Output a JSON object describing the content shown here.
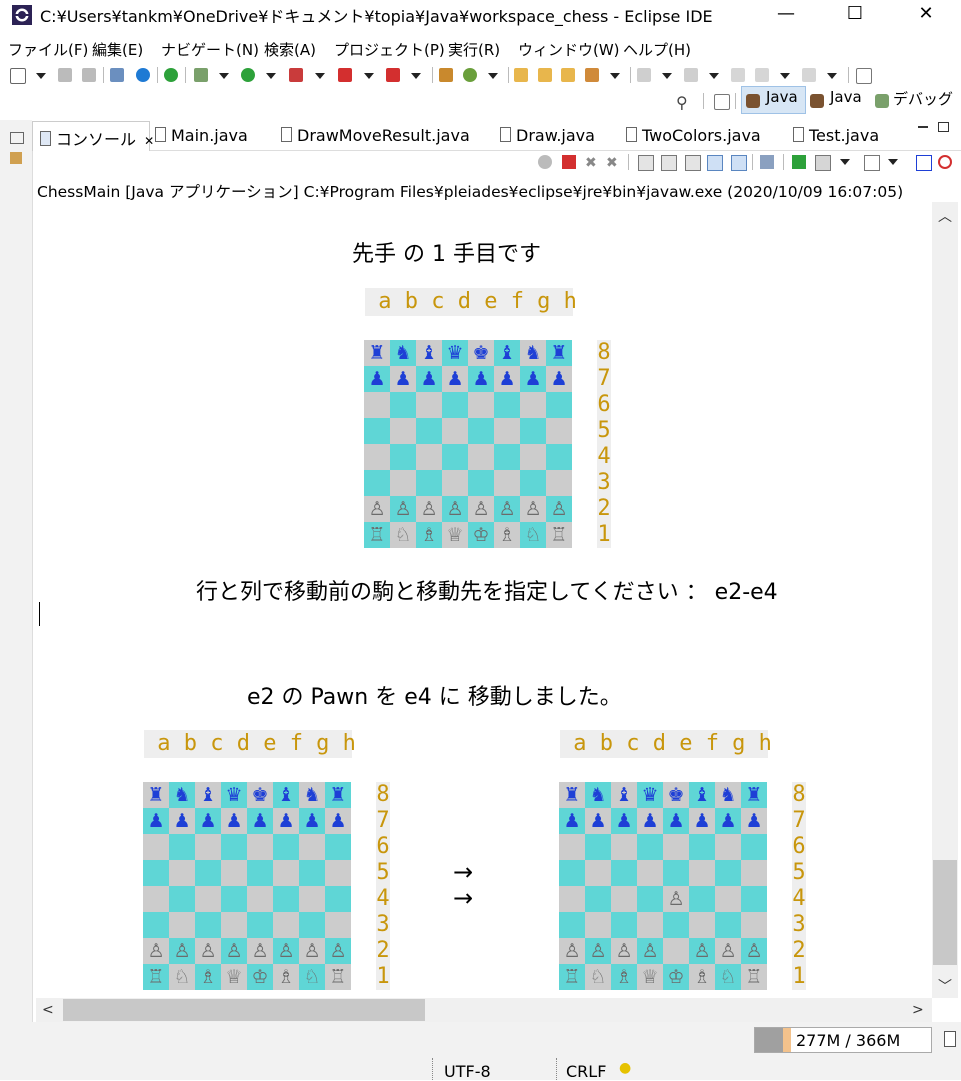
{
  "window": {
    "title": "C:¥Users¥tankm¥OneDrive¥ドキュメント¥topia¥Java¥workspace_chess - Eclipse IDE",
    "minimize_symbol": "—",
    "maximize_symbol": "☐",
    "close_symbol": "✕"
  },
  "menu": [
    "ファイル(F)",
    "編集(E)",
    "ナビゲート(N)",
    "検索(A)",
    "プロジェクト(P)",
    "実行(R)",
    "ウィンドウ(W)",
    "ヘルプ(H)"
  ],
  "perspectives": {
    "java_active": "Java",
    "java": "Java",
    "debug": "デバッグ"
  },
  "tabs": [
    "コンソール",
    "Main.java",
    "DrawMoveResult.java",
    "Draw.java",
    "TwoColors.java",
    "Test.java"
  ],
  "console": {
    "header": "ChessMain [Java アプリケーション] C:¥Program Files¥pleiades¥eclipse¥jre¥bin¥javaw.exe  (2020/10/09 16:07:05)",
    "turn_message": "先手 の 1 手目です",
    "prompt_message": "行と列で移動前の駒と移動先を指定してください ： e2-e4",
    "result_message": "e2 の Pawn を e4 に 移動しました。",
    "files_label": " a b c d e f g h",
    "ranks": [
      "8",
      "7",
      "6",
      "5",
      "4",
      "3",
      "2",
      "1"
    ],
    "arrow_symbol": "→",
    "colors": {
      "light_square": "#cccccc",
      "dark_square": "#5fd6d6",
      "black_piece": "#1e3fd6",
      "white_piece": "#6b6b6b",
      "label_text": "#c8960c",
      "label_bg": "#eeeeee"
    },
    "boards": {
      "initial": [
        [
          "♜",
          "♞",
          "♝",
          "♛",
          "♚",
          "♝",
          "♞",
          "♜"
        ],
        [
          "♟",
          "♟",
          "♟",
          "♟",
          "♟",
          "♟",
          "♟",
          "♟"
        ],
        [
          "",
          "",
          "",
          "",
          "",
          "",
          "",
          ""
        ],
        [
          "",
          "",
          "",
          "",
          "",
          "",
          "",
          ""
        ],
        [
          "",
          "",
          "",
          "",
          "",
          "",
          "",
          ""
        ],
        [
          "",
          "",
          "",
          "",
          "",
          "",
          "",
          ""
        ],
        [
          "♙",
          "♙",
          "♙",
          "♙",
          "♙",
          "♙",
          "♙",
          "♙"
        ],
        [
          "♖",
          "♘",
          "♗",
          "♕",
          "♔",
          "♗",
          "♘",
          "♖"
        ]
      ],
      "after": [
        [
          "♜",
          "♞",
          "♝",
          "♛",
          "♚",
          "♝",
          "♞",
          "♜"
        ],
        [
          "♟",
          "♟",
          "♟",
          "♟",
          "♟",
          "♟",
          "♟",
          "♟"
        ],
        [
          "",
          "",
          "",
          "",
          "",
          "",
          "",
          ""
        ],
        [
          "",
          "",
          "",
          "",
          "",
          "",
          "",
          ""
        ],
        [
          "",
          "",
          "",
          "",
          "♙",
          "",
          "",
          ""
        ],
        [
          "",
          "",
          "",
          "",
          "",
          "",
          "",
          ""
        ],
        [
          "♙",
          "♙",
          "♙",
          "♙",
          "",
          "♙",
          "♙",
          "♙"
        ],
        [
          "♖",
          "♘",
          "♗",
          "♕",
          "♔",
          "♗",
          "♘",
          "♖"
        ]
      ]
    }
  },
  "status": {
    "heap": "277M / 366M",
    "encoding": "UTF-8",
    "line_ending": "CRLF"
  }
}
